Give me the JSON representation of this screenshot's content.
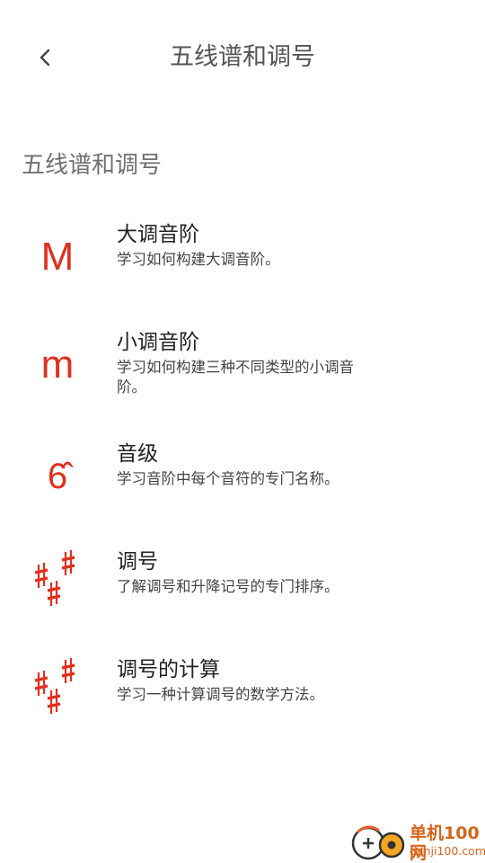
{
  "header": {
    "title": "五线谱和调号",
    "back_icon": "chevron-left-icon"
  },
  "section": {
    "title": "五线谱和调号"
  },
  "accent_color": "#e0301e",
  "lessons": [
    {
      "icon_text": "M",
      "title": "大调音阶",
      "description": "学习如何构建大调音阶。"
    },
    {
      "icon_text": "m",
      "title": "小调音阶",
      "description": "学习如何构建三种不同类型的小调音阶。"
    },
    {
      "icon_text": "6̂",
      "title": "音级",
      "description": "学习音阶中每个音符的专门名称。"
    },
    {
      "icon": "sharps-icon",
      "title": "调号",
      "description": "了解调号和升降记号的专门排序。"
    },
    {
      "icon": "sharps-icon",
      "title": "调号的计算",
      "description": "学习一种计算调号的数学方法。"
    }
  ],
  "watermark": {
    "line1": "单机100网",
    "line2": "danji100.com"
  }
}
